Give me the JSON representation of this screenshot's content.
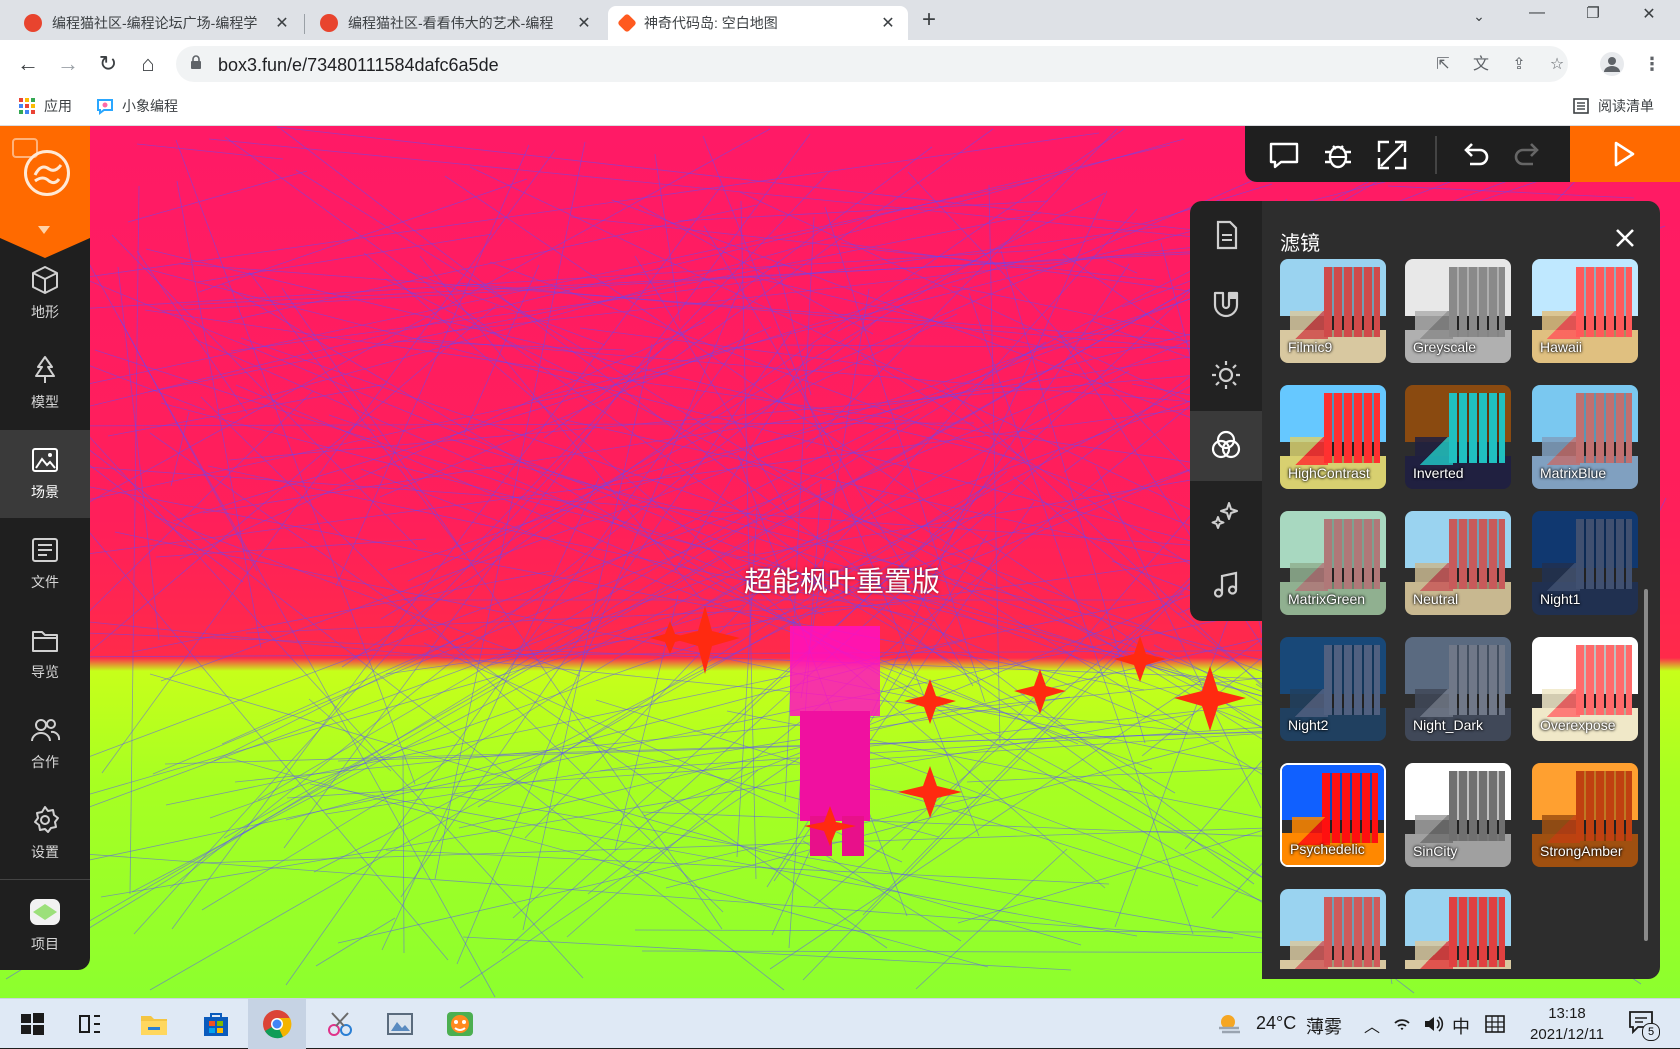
{
  "browser": {
    "tabs": [
      {
        "title": "编程猫社区-编程论坛广场-编程学",
        "favicon_color": "#e8442e",
        "active": false
      },
      {
        "title": "编程猫社区-看看伟大的艺术-编程",
        "favicon_color": "#e8442e",
        "active": false
      },
      {
        "title": "神奇代码岛: 空白地图",
        "favicon_color": "#ff5a1f",
        "active": true
      }
    ],
    "url": "box3.fun/e/73480111584dafc6a5de",
    "bookmarks": [
      {
        "label": "应用",
        "icon": "apps-grid-icon"
      },
      {
        "label": "小象编程",
        "icon": "xiaoxiang-logo-icon"
      }
    ],
    "reading_list_label": "阅读清单"
  },
  "sidebar": {
    "items": [
      {
        "label": "地形",
        "icon": "cube-icon",
        "active": false
      },
      {
        "label": "模型",
        "icon": "tree-icon",
        "active": false
      },
      {
        "label": "场景",
        "icon": "picture-icon",
        "active": true
      },
      {
        "label": "文件",
        "icon": "file-list-icon",
        "active": false
      },
      {
        "label": "导览",
        "icon": "folder-icon",
        "active": false
      },
      {
        "label": "合作",
        "icon": "users-icon",
        "active": false
      },
      {
        "label": "设置",
        "icon": "gear-icon",
        "active": false
      }
    ],
    "project": {
      "label": "项目",
      "icon": "project-avatar-icon"
    }
  },
  "scene": {
    "title": "超能枫叶重置版"
  },
  "filter_panel": {
    "title": "滤镜",
    "filters": [
      {
        "name": "Filmic9",
        "sky": "#9ad3f0",
        "ground": "#d8c8a0",
        "build": "#d04a4a",
        "selected": false
      },
      {
        "name": "Greyscale",
        "sky": "#e8e8e8",
        "ground": "#b0b0b0",
        "build": "#8a8a8a",
        "selected": false
      },
      {
        "name": "Hawaii",
        "sky": "#bfe8ff",
        "ground": "#e0c080",
        "build": "#ff5a5a",
        "selected": false
      },
      {
        "name": "HighContrast",
        "sky": "#66c8ff",
        "ground": "#d8d070",
        "build": "#ff3030",
        "selected": false
      },
      {
        "name": "Inverted",
        "sky": "#8a4a10",
        "ground": "#202040",
        "build": "#20c0c0",
        "selected": false
      },
      {
        "name": "MatrixBlue",
        "sky": "#7ac8f0",
        "ground": "#80a0c0",
        "build": "#c07070",
        "selected": false
      },
      {
        "name": "MatrixGreen",
        "sky": "#a8d8c0",
        "ground": "#90b090",
        "build": "#b07878",
        "selected": false
      },
      {
        "name": "Neutral",
        "sky": "#9ad3f0",
        "ground": "#c8b890",
        "build": "#c85a5a",
        "selected": false
      },
      {
        "name": "Night1",
        "sky": "#103870",
        "ground": "#203050",
        "build": "#405070",
        "selected": false
      },
      {
        "name": "Night2",
        "sky": "#184878",
        "ground": "#204060",
        "build": "#506080",
        "selected": false
      },
      {
        "name": "Night_Dark",
        "sky": "#5a6a80",
        "ground": "#404858",
        "build": "#707888",
        "selected": false
      },
      {
        "name": "Overexpose",
        "sky": "#ffffff",
        "ground": "#f0e8c8",
        "build": "#ff6a6a",
        "selected": false
      },
      {
        "name": "Psychedelic",
        "sky": "#1060ff",
        "ground": "#ff8800",
        "build": "#ff1010",
        "selected": true
      },
      {
        "name": "SinCity",
        "sky": "#ffffff",
        "ground": "#a0a0a0",
        "build": "#707070",
        "selected": false
      },
      {
        "name": "StrongAmber",
        "sky": "#ffa030",
        "ground": "#a05010",
        "build": "#c04010",
        "selected": false
      },
      {
        "name": "",
        "sky": "#9ad3f0",
        "ground": "#d8c8a0",
        "build": "#d05a5a",
        "selected": false
      },
      {
        "name": "",
        "sky": "#9ad3f0",
        "ground": "#d8c8a0",
        "build": "#e04040",
        "selected": false
      }
    ]
  },
  "taskbar": {
    "weather_temp": "24°C",
    "weather_desc": "薄雾",
    "ime_label": "中",
    "time": "13:18",
    "date": "2021/12/11",
    "notification_count": "5"
  },
  "colors": {
    "accent": "#ff6a00",
    "panel": "#2d2d2d",
    "sidebar": "#1f1f1f"
  }
}
